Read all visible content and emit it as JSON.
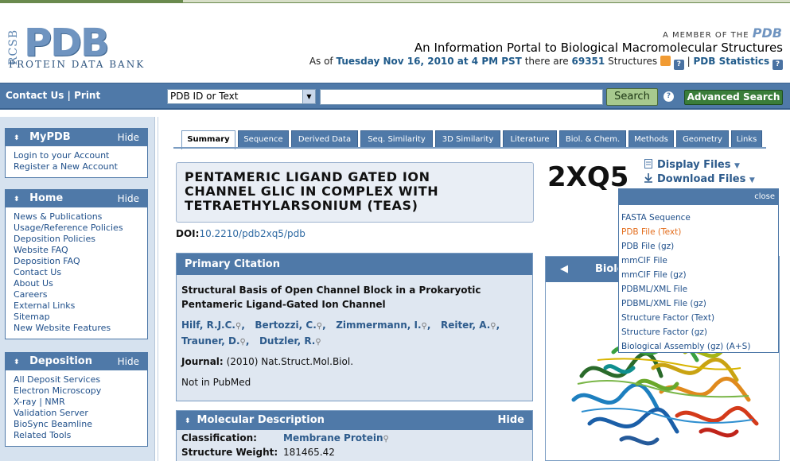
{
  "header": {
    "logo_side": "RCSB",
    "logo_main": "PDB",
    "logo_sub": "PROTEIN DATA BANK",
    "member_text": "A MEMBER OF THE",
    "member_brand": "PDB",
    "tagline": "An Information Portal to Biological Macromolecular Structures",
    "asof_prefix": "As of",
    "asof_date": "Tuesday Nov 16, 2010 at 4 PM PST",
    "asof_middle": "there are",
    "asof_count": "69351",
    "asof_suffix": "Structures",
    "stats_link": "PDB Statistics",
    "sep": "|"
  },
  "nav": {
    "contact": "Contact Us",
    "sep": "|",
    "print": "Print",
    "select_value": "PDB ID or Text",
    "search_value": "",
    "search_label": "Search",
    "advanced_label": "Advanced Search",
    "help": "?"
  },
  "sidebar": {
    "mypdb": {
      "title": "MyPDB",
      "hide": "Hide",
      "items": [
        "Login to your Account",
        "Register a New Account"
      ]
    },
    "home": {
      "title": "Home",
      "hide": "Hide",
      "items": [
        "News & Publications",
        "Usage/Reference Policies",
        "Deposition Policies",
        "Website FAQ",
        "Deposition FAQ",
        "Contact Us",
        "About Us",
        "Careers",
        "External Links",
        "Sitemap",
        "New Website Features"
      ]
    },
    "deposition": {
      "title": "Deposition",
      "hide": "Hide",
      "items": [
        "All Deposit Services",
        "Electron Microscopy",
        "X-ray | NMR",
        "Validation Server",
        "BioSync Beamline",
        "Related Tools"
      ]
    }
  },
  "tabs": [
    "Summary",
    "Sequence",
    "Derived Data",
    "Seq. Similarity",
    "3D Similarity",
    "Literature",
    "Biol. & Chem.",
    "Methods",
    "Geometry",
    "Links"
  ],
  "structure": {
    "title_lines": [
      "PENTAMERIC LIGAND GATED ION",
      "CHANNEL GLIC IN COMPLEX WITH",
      "TETRAETHYLARSONIUM (TEAS)"
    ],
    "doi_label": "DOI:",
    "doi_value": "10.2210/pdb2xq5/pdb",
    "id": "2XQ5",
    "display_files": "Display Files",
    "download_files": "Download Files"
  },
  "citation": {
    "header": "Primary Citation",
    "title_lines": [
      "Structural Basis of Open Channel Block in a Prokaryotic",
      "Pentameric Ligand-Gated Ion Channel"
    ],
    "authors_line1": [
      "Hilf, R.J.C.",
      "Bertozzi, C.",
      "Zimmermann, I.",
      "Reiter, A."
    ],
    "authors_line2": [
      "Trauner, D.",
      "Dutzler, R."
    ],
    "journal_label": "Journal:",
    "journal_value": "(2010) Nat.Struct.Mol.Biol.",
    "pubmed": "Not in PubMed"
  },
  "molecular": {
    "header": "Molecular Description",
    "hide": "Hide",
    "classification_label": "Classification:",
    "classification_value": "Membrane Protein",
    "weight_label": "Structure Weight:",
    "weight_value": "181465.42"
  },
  "biol_panel": {
    "title": "Biolo"
  },
  "download_menu": {
    "close": "close",
    "items": [
      "FASTA Sequence",
      "PDB File (Text)",
      "PDB File (gz)",
      "mmCIF File",
      "mmCIF File (gz)",
      "PDBML/XML File",
      "PDBML/XML File (gz)",
      "Structure Factor (Text)",
      "Structure Factor (gz)",
      "Biological Assembly (gz) (A+S)"
    ]
  },
  "colors": {
    "accent": "#4f79a8",
    "link": "#2d5b8c",
    "highlight_link": "#e36d1c",
    "search_button": "#a7c98e",
    "advanced_button": "#3a7d3a"
  }
}
